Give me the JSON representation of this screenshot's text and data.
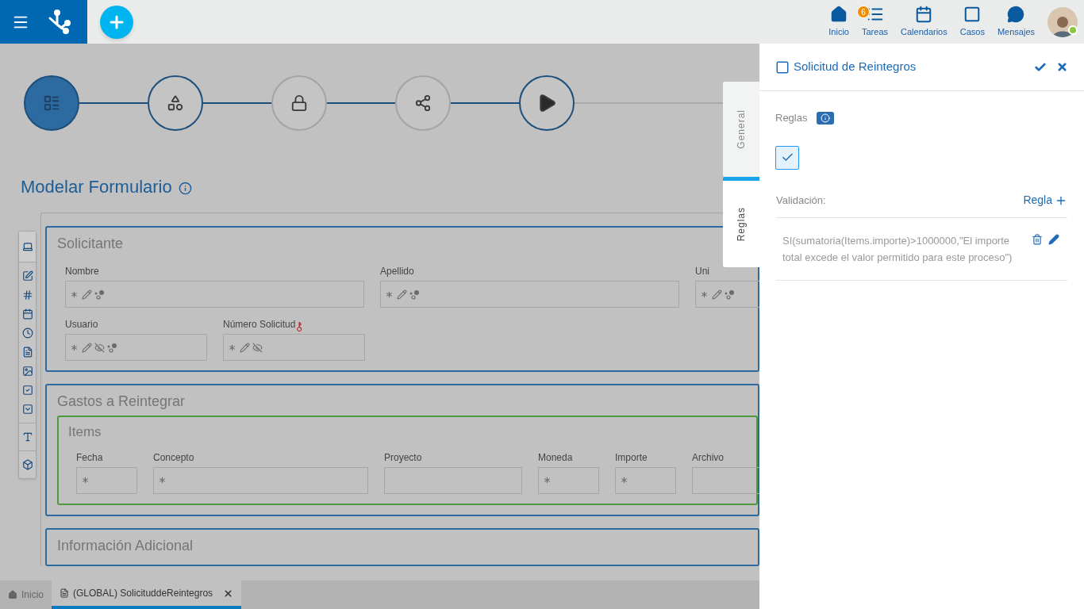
{
  "header": {
    "nav": [
      {
        "kind": "home",
        "label": "Inicio"
      },
      {
        "kind": "tasks",
        "label": "Tareas",
        "badge": "6"
      },
      {
        "kind": "calendar",
        "label": "Calendarios"
      },
      {
        "kind": "cases",
        "label": "Casos"
      },
      {
        "kind": "messages",
        "label": "Mensajes"
      }
    ],
    "avatar": {
      "online": true
    }
  },
  "stepper": {
    "steps": [
      {
        "kind": "form",
        "selected": true,
        "enabled": true
      },
      {
        "kind": "shapes",
        "selected": false,
        "enabled": true
      },
      {
        "kind": "lock",
        "selected": false,
        "enabled": false
      },
      {
        "kind": "share",
        "selected": false,
        "enabled": false
      },
      {
        "kind": "play",
        "selected": false,
        "enabled": true
      }
    ]
  },
  "page_title": "Modelar Formulario",
  "toolbox": {
    "groups": [
      {
        "tools": [
          {
            "kind": "laptop"
          }
        ]
      },
      {
        "tools": [
          {
            "kind": "edit"
          },
          {
            "kind": "number"
          },
          {
            "kind": "date"
          },
          {
            "kind": "time"
          },
          {
            "kind": "file"
          },
          {
            "kind": "image"
          },
          {
            "kind": "checkbox"
          },
          {
            "kind": "dropdown"
          }
        ]
      },
      {
        "tools": [
          {
            "kind": "text"
          }
        ]
      },
      {
        "tools": [
          {
            "kind": "cube"
          }
        ]
      }
    ]
  },
  "sections": [
    {
      "title": "Solicitante",
      "rows": [
        [
          {
            "label": "Nombre",
            "icons": [
              {
                "kind": "required"
              },
              {
                "kind": "edit"
              },
              {
                "kind": "link"
              }
            ]
          },
          {
            "label": "Apellido",
            "icons": [
              {
                "kind": "required"
              },
              {
                "kind": "edit"
              },
              {
                "kind": "link"
              }
            ]
          },
          {
            "label": "Uni",
            "icons": [
              {
                "kind": "required"
              },
              {
                "kind": "edit"
              },
              {
                "kind": "link"
              }
            ]
          }
        ],
        [
          {
            "label": "Usuario",
            "icons": [
              {
                "kind": "required"
              },
              {
                "kind": "edit"
              },
              {
                "kind": "hidden"
              },
              {
                "kind": "link"
              }
            ]
          },
          {
            "label": "Número Solicitud",
            "key": true,
            "icons": [
              {
                "kind": "required"
              },
              {
                "kind": "edit"
              },
              {
                "kind": "hidden"
              }
            ]
          }
        ]
      ]
    },
    {
      "title": "Gastos a Reintegrar",
      "grid": {
        "title": "Items",
        "columns": [
          {
            "label": "Fecha",
            "icons": [
              {
                "kind": "required"
              }
            ]
          },
          {
            "label": "Concepto",
            "icons": [
              {
                "kind": "required"
              }
            ]
          },
          {
            "label": "Proyecto"
          },
          {
            "label": "Moneda",
            "icons": [
              {
                "kind": "required"
              }
            ]
          },
          {
            "label": "Importe",
            "icons": [
              {
                "kind": "required"
              }
            ]
          },
          {
            "label": "Archivo"
          }
        ]
      }
    },
    {
      "title": "Información Adicional"
    }
  ],
  "bottom_tabs": [
    {
      "kind": "home",
      "label": "Inicio",
      "selected": false,
      "closable": false
    },
    {
      "kind": "form",
      "label": "(GLOBAL) SolicituddeReintegros",
      "selected": true,
      "closable": true
    }
  ],
  "panel": {
    "title": "Solicitud de Reintegros",
    "tabs": [
      {
        "label": "General",
        "selected": false
      },
      {
        "label": "Reglas",
        "selected": true
      }
    ],
    "rules_label": "Reglas",
    "enabled_checked": true,
    "validation_label": "Validación:",
    "add_rule": "Regla",
    "rules": [
      "SI(sumatoria(Items.importe)>1000000,\"El importe total excede el valor permitido para este proceso\")"
    ]
  }
}
